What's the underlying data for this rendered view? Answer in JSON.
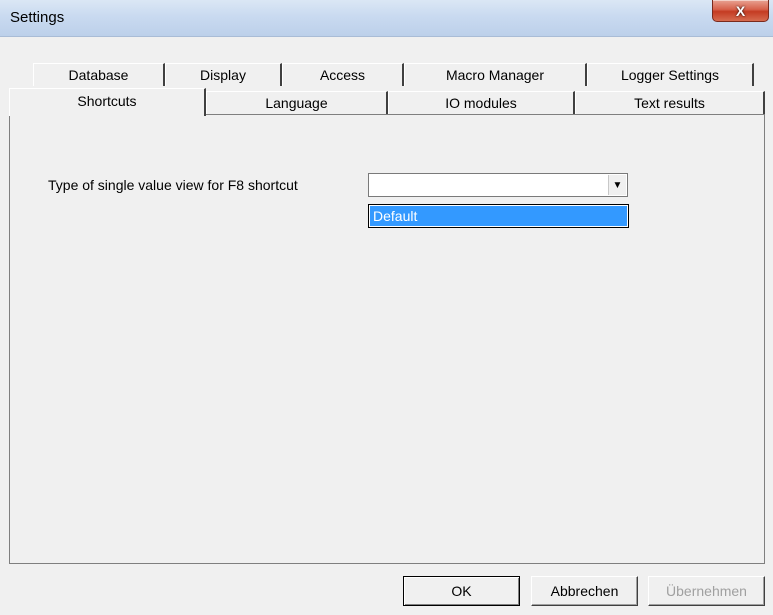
{
  "window": {
    "title": "Settings",
    "close_glyph": "X"
  },
  "tabs": {
    "row1": [
      {
        "label": "Database"
      },
      {
        "label": "Display"
      },
      {
        "label": "Access"
      },
      {
        "label": "Macro Manager"
      },
      {
        "label": "Logger Settings"
      }
    ],
    "row2": [
      {
        "label": "Shortcuts",
        "selected": true
      },
      {
        "label": "Language"
      },
      {
        "label": "IO modules"
      },
      {
        "label": "Text results"
      }
    ]
  },
  "shortcuts": {
    "f8_label": "Type of single value view for F8 shortcut",
    "combo_value": "",
    "dropdown_options": [
      "Default"
    ],
    "highlight_color": "#3399ff"
  },
  "buttons": {
    "ok": "OK",
    "cancel": "Abbrechen",
    "apply": "Übernehmen"
  }
}
